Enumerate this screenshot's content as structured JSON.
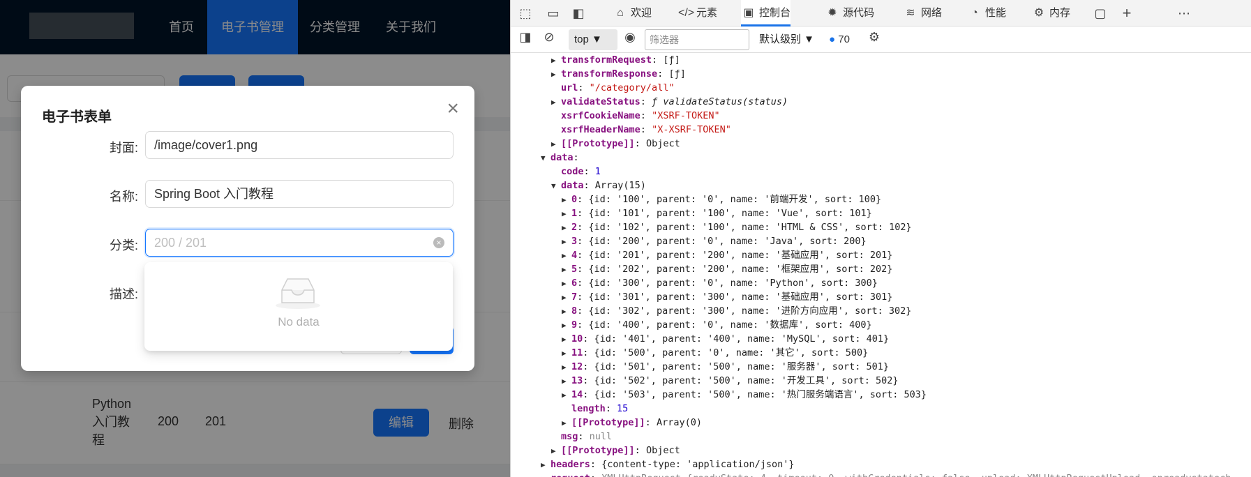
{
  "app": {
    "nav": [
      "首页",
      "电子书管理",
      "分类管理",
      "关于我们"
    ],
    "nav_active": 1,
    "row": {
      "name_lines": [
        "Python",
        "入门教",
        "程"
      ],
      "c1": "200",
      "c2": "201",
      "edit": "编辑",
      "delete": "删除"
    }
  },
  "modal": {
    "title": "电子书表单",
    "close": "×",
    "fields": [
      {
        "label": "封面:",
        "value": "/image/cover1.png"
      },
      {
        "label": "名称:",
        "value": "Spring Boot 入门教程"
      },
      {
        "label": "分类:",
        "placeholder": "200 / 201"
      },
      {
        "label": "描述:"
      }
    ],
    "dropdown_empty": "No data"
  },
  "devtools": {
    "tabs": [
      "欢迎",
      "元素",
      "控制台",
      "源代码",
      "网络",
      "性能",
      "内存"
    ],
    "active_tab": 2,
    "context": "top",
    "filter_placeholder": "筛选器",
    "level": "默认级别",
    "message_count": "70",
    "lines": [
      {
        "i": 4,
        "t": "▶",
        "k": "transformRequest",
        "v": "[ƒ]",
        "c": "obj"
      },
      {
        "i": 4,
        "t": "▶",
        "k": "transformResponse",
        "v": "[ƒ]",
        "c": "obj"
      },
      {
        "i": 4,
        "t": "",
        "k": "url",
        "v": "\"/category/all\"",
        "c": "str"
      },
      {
        "i": 4,
        "t": "▶",
        "k": "validateStatus",
        "v": "ƒ validateStatus(status)",
        "c": "fn"
      },
      {
        "i": 4,
        "t": "",
        "k": "xsrfCookieName",
        "v": "\"XSRF-TOKEN\"",
        "c": "str"
      },
      {
        "i": 4,
        "t": "",
        "k": "xsrfHeaderName",
        "v": "\"X-XSRF-TOKEN\"",
        "c": "str"
      },
      {
        "i": 4,
        "t": "▶",
        "k": "[[Prototype]]",
        "v": "Object",
        "c": "obj"
      },
      {
        "i": 3,
        "t": "▼",
        "k": "data",
        "v": "",
        "c": "obj"
      },
      {
        "i": 4,
        "t": "",
        "k": "code",
        "v": "1",
        "c": "num"
      },
      {
        "i": 4,
        "t": "▼",
        "k": "data",
        "v": "Array(15)",
        "c": "obj"
      },
      {
        "i": 5,
        "t": "▶",
        "k": "0",
        "v": "{id: '100', parent: '0', name: '前端开发', sort: 100}",
        "c": "obj"
      },
      {
        "i": 5,
        "t": "▶",
        "k": "1",
        "v": "{id: '101', parent: '100', name: 'Vue', sort: 101}",
        "c": "obj"
      },
      {
        "i": 5,
        "t": "▶",
        "k": "2",
        "v": "{id: '102', parent: '100', name: 'HTML & CSS', sort: 102}",
        "c": "obj"
      },
      {
        "i": 5,
        "t": "▶",
        "k": "3",
        "v": "{id: '200', parent: '0', name: 'Java', sort: 200}",
        "c": "obj"
      },
      {
        "i": 5,
        "t": "▶",
        "k": "4",
        "v": "{id: '201', parent: '200', name: '基础应用', sort: 201}",
        "c": "obj"
      },
      {
        "i": 5,
        "t": "▶",
        "k": "5",
        "v": "{id: '202', parent: '200', name: '框架应用', sort: 202}",
        "c": "obj"
      },
      {
        "i": 5,
        "t": "▶",
        "k": "6",
        "v": "{id: '300', parent: '0', name: 'Python', sort: 300}",
        "c": "obj"
      },
      {
        "i": 5,
        "t": "▶",
        "k": "7",
        "v": "{id: '301', parent: '300', name: '基础应用', sort: 301}",
        "c": "obj"
      },
      {
        "i": 5,
        "t": "▶",
        "k": "8",
        "v": "{id: '302', parent: '300', name: '进阶方向应用', sort: 302}",
        "c": "obj"
      },
      {
        "i": 5,
        "t": "▶",
        "k": "9",
        "v": "{id: '400', parent: '0', name: '数据库', sort: 400}",
        "c": "obj"
      },
      {
        "i": 5,
        "t": "▶",
        "k": "10",
        "v": "{id: '401', parent: '400', name: 'MySQL', sort: 401}",
        "c": "obj"
      },
      {
        "i": 5,
        "t": "▶",
        "k": "11",
        "v": "{id: '500', parent: '0', name: '其它', sort: 500}",
        "c": "obj"
      },
      {
        "i": 5,
        "t": "▶",
        "k": "12",
        "v": "{id: '501', parent: '500', name: '服务器', sort: 501}",
        "c": "obj"
      },
      {
        "i": 5,
        "t": "▶",
        "k": "13",
        "v": "{id: '502', parent: '500', name: '开发工具', sort: 502}",
        "c": "obj"
      },
      {
        "i": 5,
        "t": "▶",
        "k": "14",
        "v": "{id: '503', parent: '500', name: '热门服务端语言', sort: 503}",
        "c": "obj"
      },
      {
        "i": 5,
        "t": "",
        "k": "length",
        "v": "15",
        "c": "num"
      },
      {
        "i": 5,
        "t": "▶",
        "k": "[[Prototype]]",
        "v": "Array(0)",
        "c": "obj"
      },
      {
        "i": 4,
        "t": "",
        "k": "msg",
        "v": "null",
        "c": "grey"
      },
      {
        "i": 4,
        "t": "▶",
        "k": "[[Prototype]]",
        "v": "Object",
        "c": "obj"
      },
      {
        "i": 3,
        "t": "▶",
        "k": "headers",
        "v": "{content-type: 'application/json'}",
        "c": "obj"
      },
      {
        "i": 3,
        "t": "▶",
        "k": "request",
        "v": "XMLHttpRequest {readyState: 4, timeout: 0, withCredentials: false, upload: XMLHttpRequestUpload, onreadystatech",
        "c": "grey"
      }
    ]
  }
}
